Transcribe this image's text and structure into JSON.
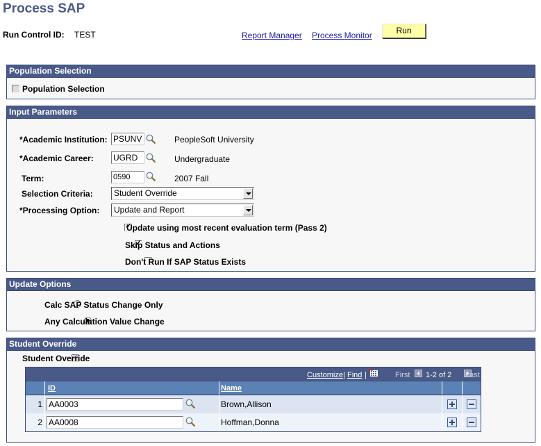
{
  "page": {
    "title": "Process SAP",
    "run_control_label": "Run Control ID:",
    "run_control_value": "TEST",
    "links": {
      "report_manager": "Report Manager",
      "process_monitor": "Process Monitor"
    },
    "run_button": "Run"
  },
  "population_selection": {
    "header": "Population Selection",
    "checkbox_label": "Population Selection",
    "checked": false,
    "disabled": true
  },
  "input_parameters": {
    "header": "Input Parameters",
    "academic_institution": {
      "label": "*Academic Institution:",
      "value": "PSUNV",
      "description": "PeopleSoft University"
    },
    "academic_career": {
      "label": "*Academic Career:",
      "value": "UGRD",
      "description": "Undergraduate"
    },
    "term": {
      "label": "Term:",
      "value": "0590",
      "description": "2007 Fall"
    },
    "selection_criteria": {
      "label": "Selection Criteria:",
      "selected": "Student Override"
    },
    "processing_option": {
      "label": "*Processing Option:",
      "selected": "Update and Report"
    },
    "checkboxes": [
      {
        "label": "Update using most recent evaluation term (Pass 2)",
        "checked": true
      },
      {
        "label": "Skip Status and Actions",
        "checked": true
      },
      {
        "label": "Don't Run If SAP Status Exists",
        "checked": false
      }
    ]
  },
  "update_options": {
    "header": "Update Options",
    "radios": [
      {
        "label": "Calc SAP Status Change Only",
        "selected": false
      },
      {
        "label": "Any Calculation Value Change",
        "selected": true
      }
    ]
  },
  "student_override": {
    "header": "Student Override",
    "checkbox_label": "Student Override",
    "checked": true,
    "disabled": true,
    "grid": {
      "nav": {
        "customize": "Customize",
        "find": "Find",
        "sep": "|",
        "first": "First",
        "range": "1-2 of 2",
        "last": "Last"
      },
      "columns": {
        "id": "ID",
        "name": "Name"
      },
      "rows": [
        {
          "num": "1",
          "id": "AA0003",
          "name": "Brown,Allison"
        },
        {
          "num": "2",
          "id": "AA0008",
          "name": "Hoffman,Donna"
        }
      ]
    }
  },
  "colors": {
    "section_header": "#495a89",
    "grid_header": "#5a82b4",
    "run_button": "#ffffa8",
    "title": "#4a5a8a"
  }
}
